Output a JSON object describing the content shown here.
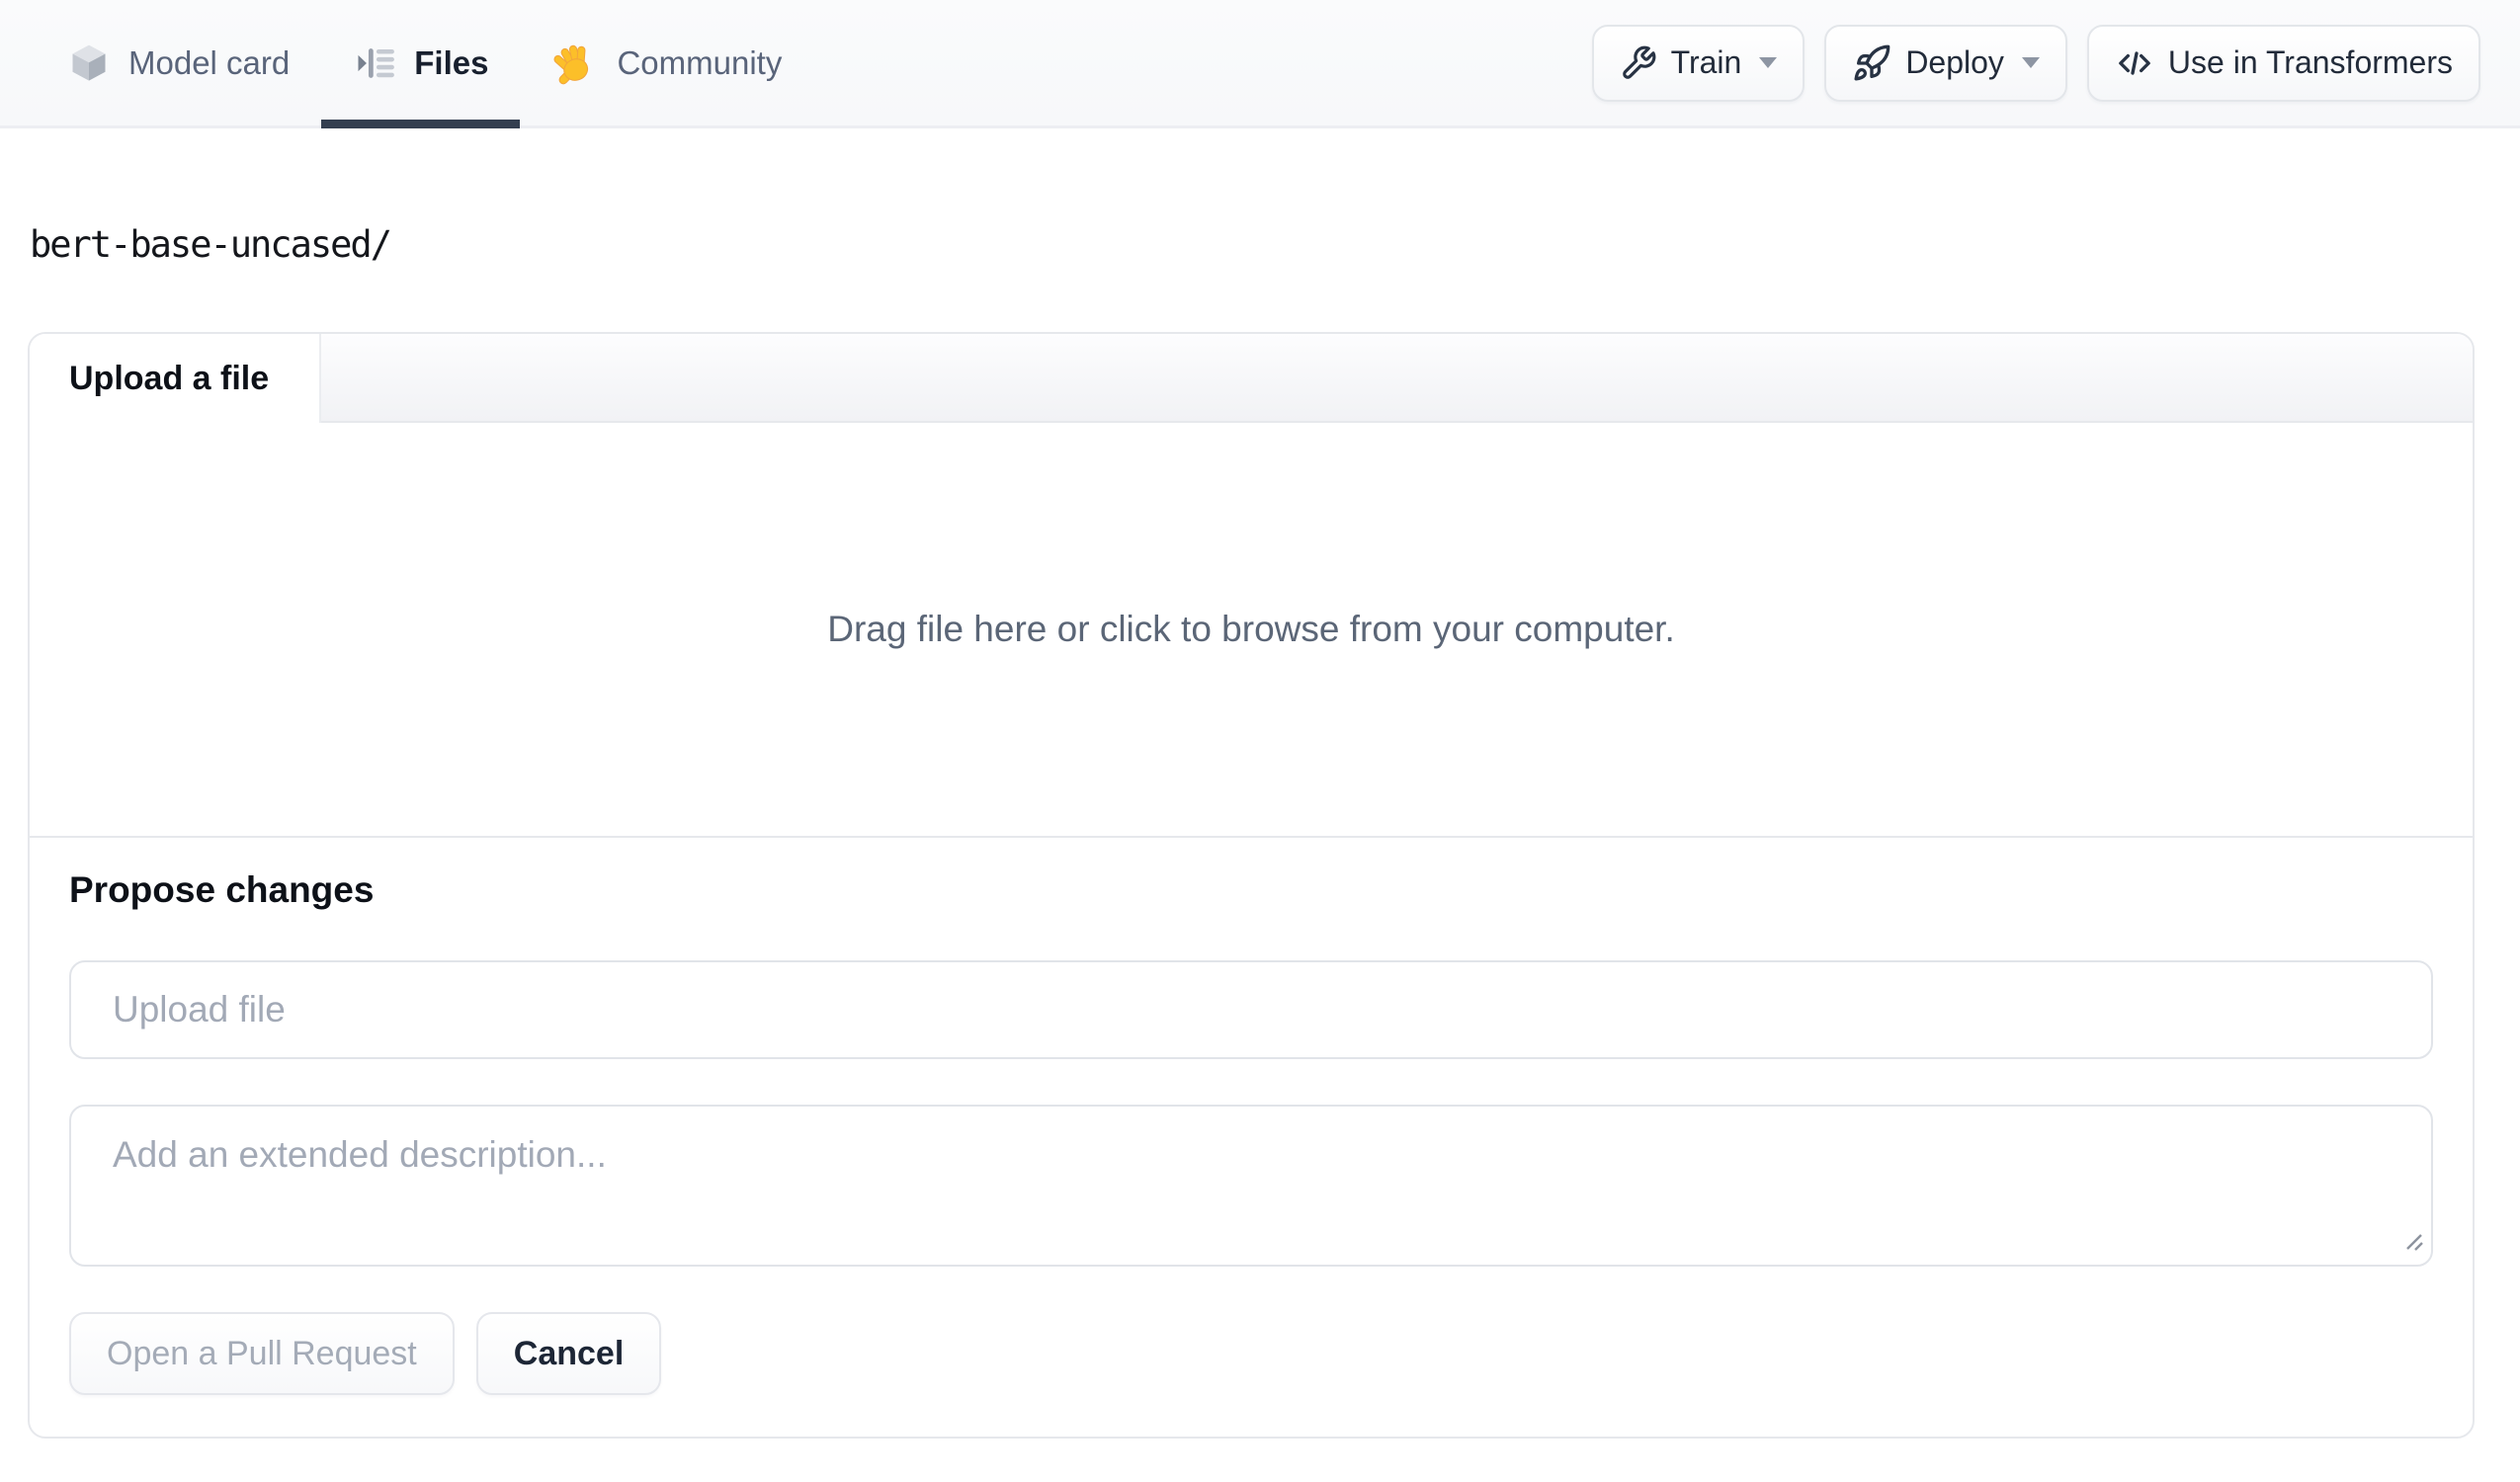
{
  "nav": {
    "tabs": [
      {
        "label": "Model card",
        "icon": "cube-icon",
        "active": false
      },
      {
        "label": "Files",
        "icon": "file-versions-icon",
        "active": true
      },
      {
        "label": "Community",
        "icon": "waving-hand-icon",
        "active": false
      }
    ],
    "actions": {
      "train_label": "Train",
      "train_icon": "wrench-icon",
      "deploy_label": "Deploy",
      "deploy_icon": "rocket-icon",
      "use_label": "Use in Transformers",
      "use_icon": "code-icon"
    }
  },
  "repo": {
    "path": "bert-base-uncased/"
  },
  "upload_panel": {
    "tab_label": "Upload a file",
    "dropzone_text": "Drag file here or click to browse from your computer.",
    "propose": {
      "heading": "Propose changes",
      "file_input_placeholder": "Upload file",
      "description_placeholder": "Add an extended description...",
      "open_pr_label": "Open a Pull Request",
      "cancel_label": "Cancel"
    }
  },
  "colors": {
    "active_tab_underline": "#343f50",
    "active_tab_text": "#18202e",
    "inactive_tab_text": "#59647a",
    "nav_background": "#f8f9fb",
    "panel_border": "#e6e8ec",
    "tabbar_gradient_bottom": "#f1f2f5",
    "placeholder_text": "#a2a9b6",
    "dropzone_text": "#5b6677",
    "disabled_button_text": "#a4abb7",
    "emoji_hand": "#fcbf29"
  }
}
